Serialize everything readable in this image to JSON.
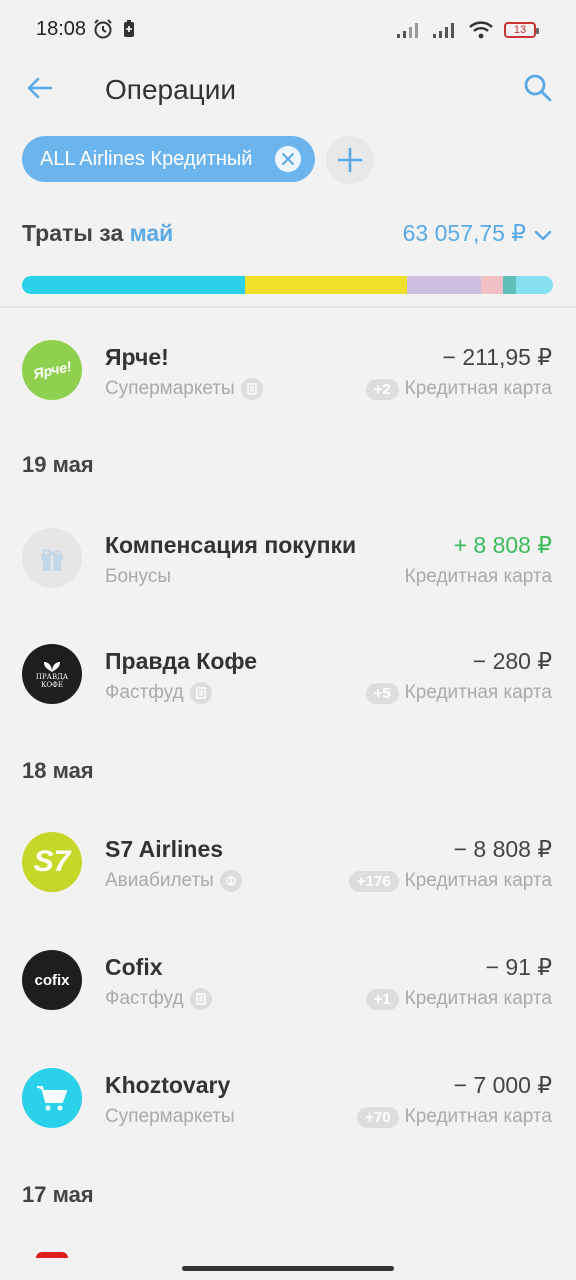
{
  "status_bar": {
    "time": "18:08",
    "battery": "13"
  },
  "header": {
    "title": "Операции"
  },
  "filter_chip": {
    "label": "ALL Airlines Кредитный"
  },
  "spending": {
    "label": "Траты за ",
    "month": "май",
    "total": "63 057,75 ₽",
    "segments": [
      {
        "color": "#2bd1e8",
        "fraction": 0.42
      },
      {
        "color": "#f0e02a",
        "fraction": 0.305
      },
      {
        "color": "#cdbfe0",
        "fraction": 0.14
      },
      {
        "color": "#f0c0c4",
        "fraction": 0.04
      },
      {
        "color": "#5ec0b8",
        "fraction": 0.025
      },
      {
        "color": "#86e0f0",
        "fraction": 0.07
      }
    ]
  },
  "transactions": {
    "yarche": {
      "name": "Ярче!",
      "category": "Супермаркеты",
      "amount": "− 211,95 ₽",
      "badge": "+2",
      "account": "Кредитная карта",
      "logo_text": "Ярче!"
    },
    "date1": "19 мая",
    "compensation": {
      "name": "Компенсация покупки",
      "category": "Бонусы",
      "amount": "+ 8 808 ₽",
      "account": "Кредитная карта"
    },
    "pravda": {
      "name": "Правда Кофе",
      "category": "Фастфуд",
      "amount": "− 280 ₽",
      "badge": "+5",
      "account": "Кредитная карта",
      "logo_text_1": "ПРАВДА",
      "logo_text_2": "КОФЕ"
    },
    "date2": "18 мая",
    "s7": {
      "name": "S7 Airlines",
      "category": "Авиабилеты",
      "amount": "− 8 808 ₽",
      "badge": "+176",
      "account": "Кредитная карта",
      "logo_text": "S7"
    },
    "cofix": {
      "name": "Cofix",
      "category": "Фастфуд",
      "amount": "− 91 ₽",
      "badge": "+1",
      "account": "Кредитная карта",
      "logo_text": "cofix"
    },
    "khoz": {
      "name": "Khoztovary",
      "category": "Супермаркеты",
      "amount": "− 7 000 ₽",
      "badge": "+70",
      "account": "Кредитная карта"
    },
    "date3": "17 мая"
  },
  "icons": [
    "back-arrow-icon",
    "search-icon",
    "close-icon",
    "plus-icon",
    "chevron-down-icon",
    "gift-icon",
    "shopping-cart-icon",
    "receipt-icon",
    "plane-icon"
  ]
}
